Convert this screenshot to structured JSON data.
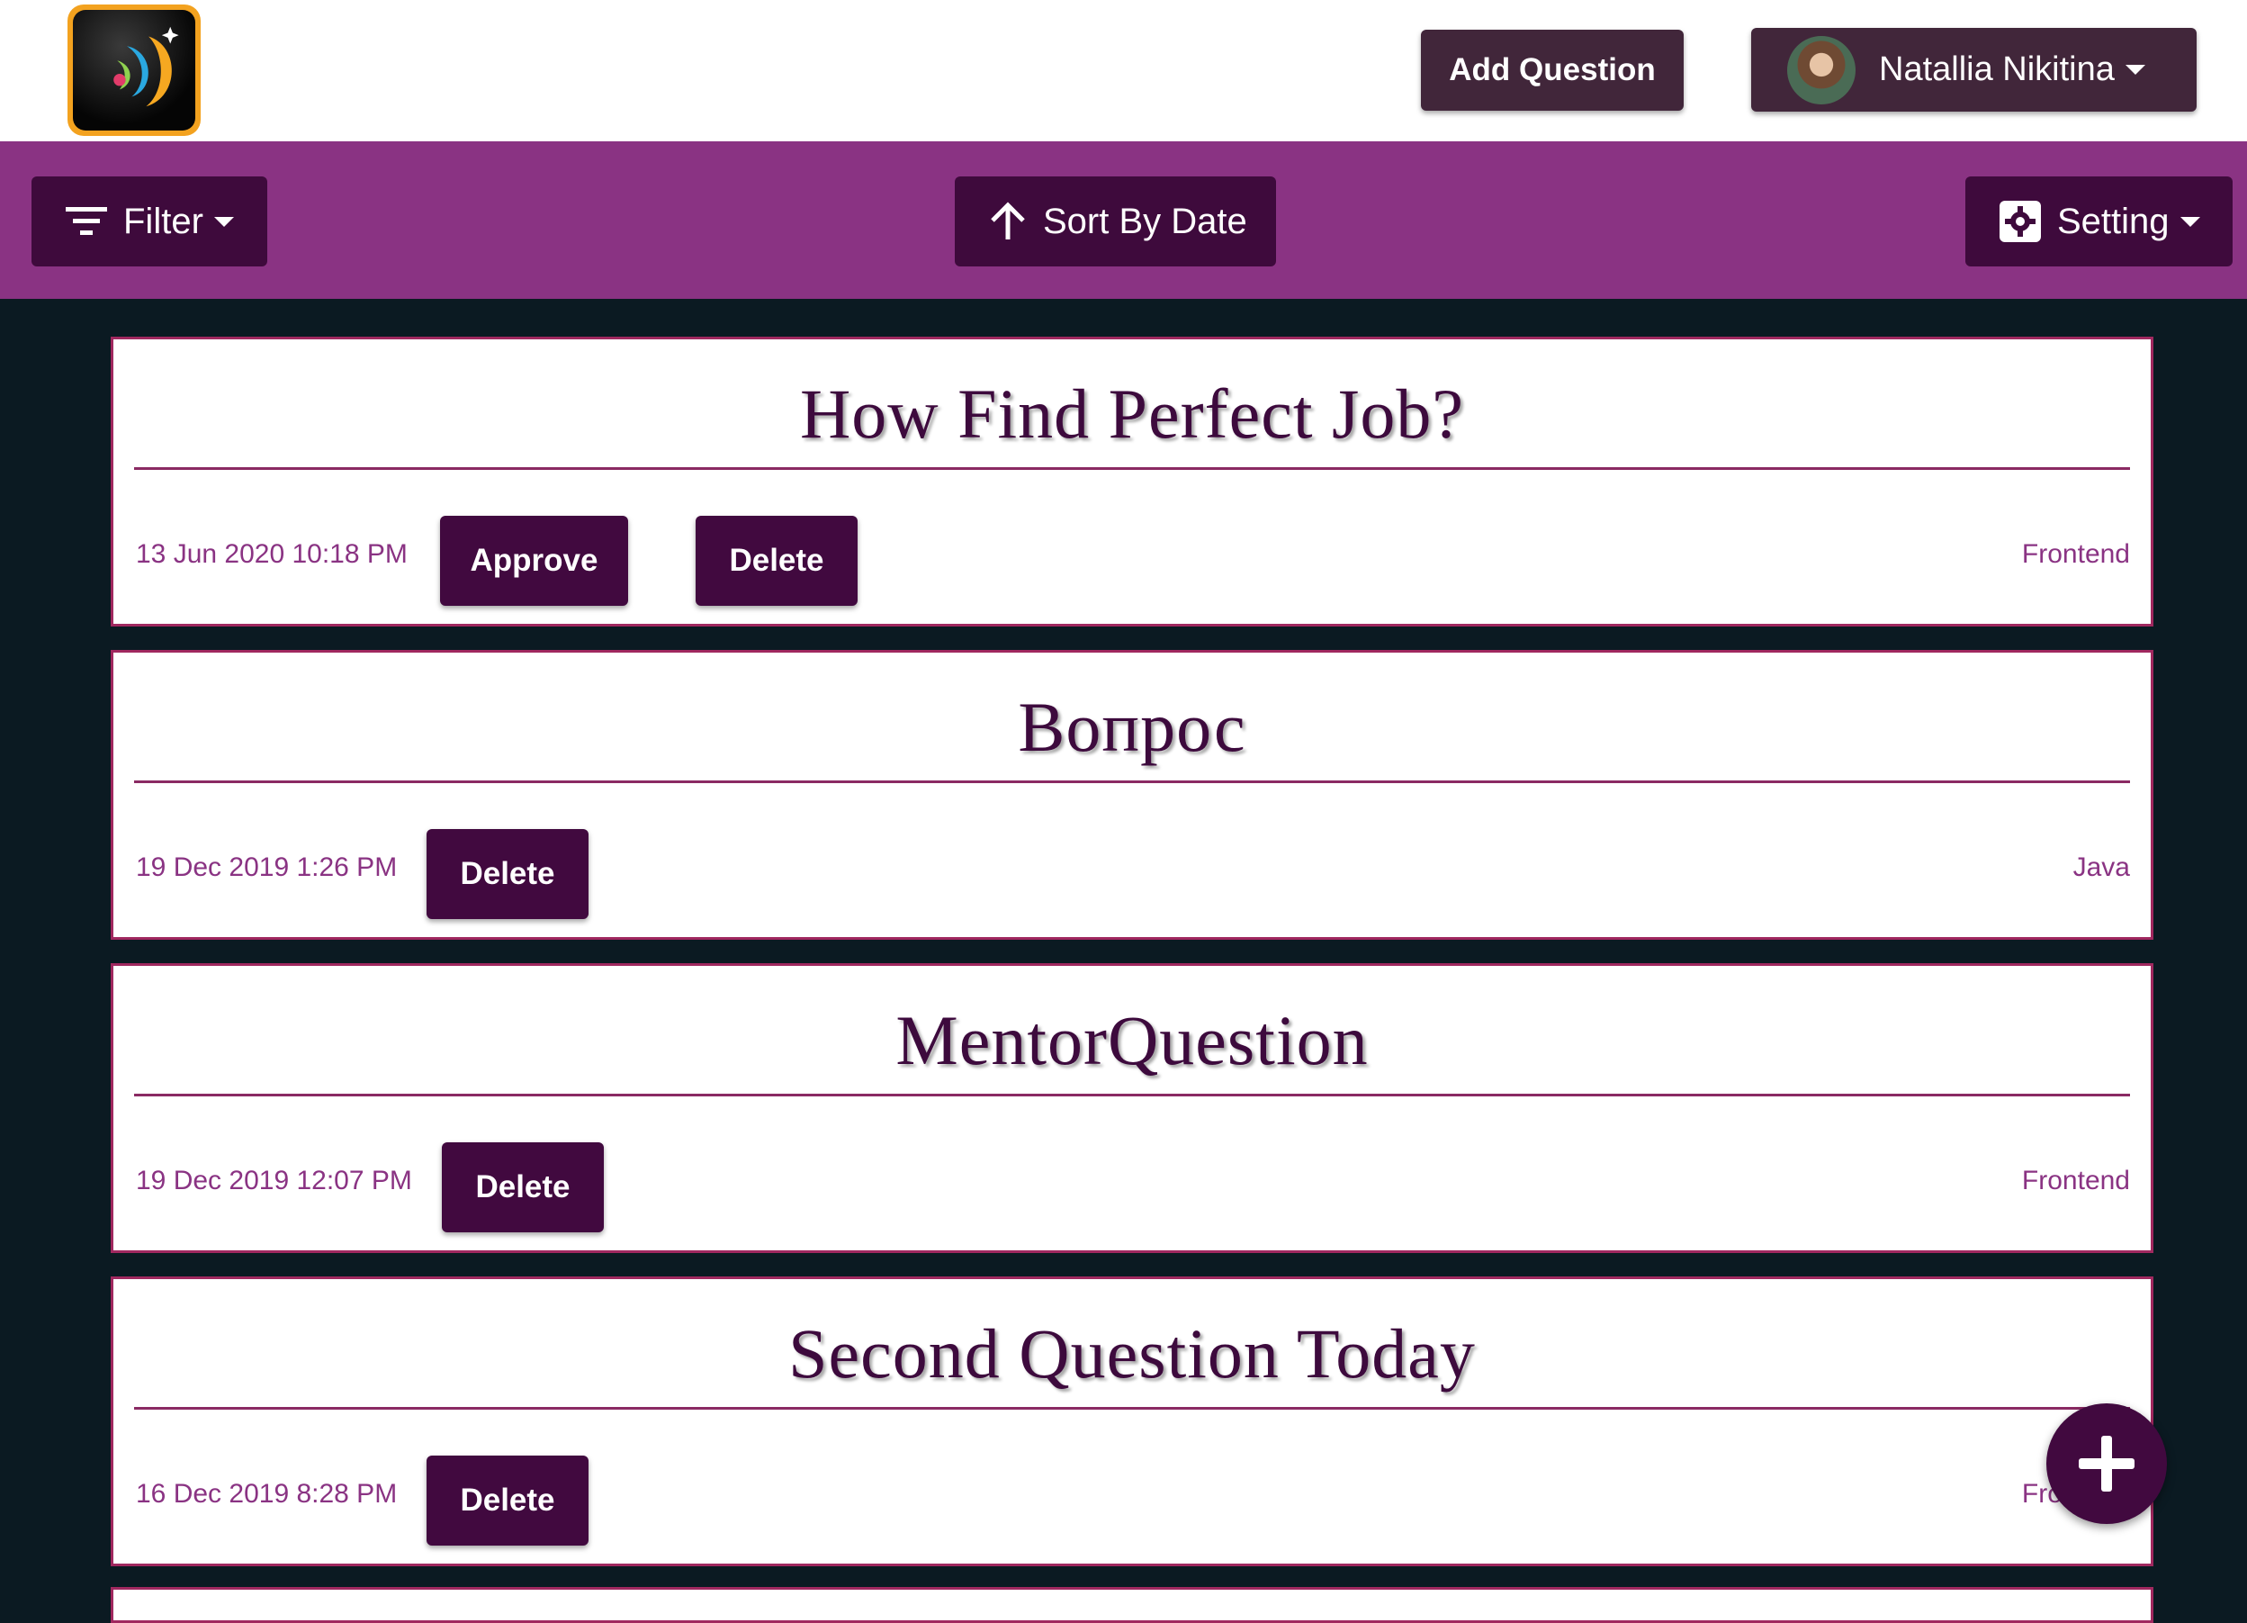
{
  "header": {
    "add_question_label": "Add Question",
    "user": {
      "name": "Natallia Nikitina"
    }
  },
  "toolbar": {
    "filter_label": "Filter",
    "sort_label": "Sort By Date",
    "setting_label": "Setting"
  },
  "colors": {
    "primary_dark": "#41093f",
    "toolbar_purple": "#8a3383",
    "page_background": "#0b1a22",
    "card_border": "#a0285f"
  },
  "questions": [
    {
      "title": "How Find Perfect Job?",
      "date": "13 Jun 2020 10:18 PM",
      "approve_label": "Approve",
      "delete_label": "Delete",
      "tag": "Frontend"
    },
    {
      "title": "Вопрос",
      "date": "19 Dec 2019 1:26 PM",
      "delete_label": "Delete",
      "tag": "Java"
    },
    {
      "title": "MentorQuestion",
      "date": "19 Dec 2019 12:07 PM",
      "delete_label": "Delete",
      "tag": "Frontend"
    },
    {
      "title": "Second Question Today",
      "date": "16 Dec 2019 8:28 PM",
      "delete_label": "Delete",
      "tag": "Frontend"
    }
  ],
  "icons": {
    "logo": "app-logo",
    "filter": "filter-lines-icon",
    "sort": "arrow-up-icon",
    "setting": "gear-icon",
    "fab": "plus-icon"
  }
}
